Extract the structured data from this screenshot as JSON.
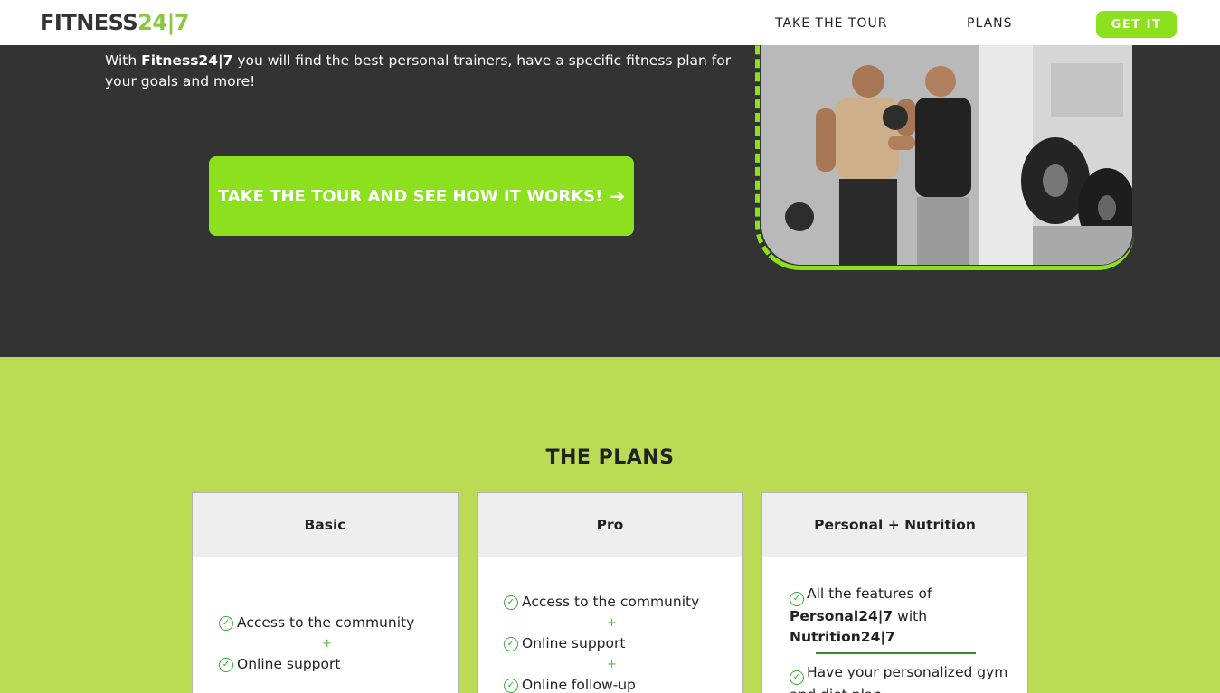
{
  "nav": {
    "logo_main": "FITNESS",
    "logo_accent": "24|7",
    "links": [
      "TAKE THE TOUR",
      "PLANS"
    ],
    "cta": "GET IT"
  },
  "hero": {
    "text_prefix": "With ",
    "text_brand": "Fitness24|7",
    "text_suffix": " you will find the best personal trainers, have a specific fitness plan for your goals and more!",
    "button": "TAKE THE TOUR AND SEE HOW IT WORKS!",
    "button_icon": "arrow-right-icon"
  },
  "plans": {
    "title": "THE PLANS",
    "cards": [
      {
        "name": "Basic",
        "features": [
          "Access to the community",
          "Online support"
        ]
      },
      {
        "name": "Pro",
        "features": [
          "Access to the community",
          "Online support",
          "Online follow-up"
        ]
      },
      {
        "name": "Personal + Nutrition",
        "intro_prefix": "All the features of ",
        "intro_b1": "Personal24|7",
        "intro_mid": " with ",
        "intro_b2": "Nutrition24|7",
        "features": [
          "Have your personalized gym and diet plan"
        ]
      }
    ]
  },
  "colors": {
    "accent": "#8ce01e",
    "plans_bg": "#bcdb55",
    "hero_bg": "#333333"
  }
}
